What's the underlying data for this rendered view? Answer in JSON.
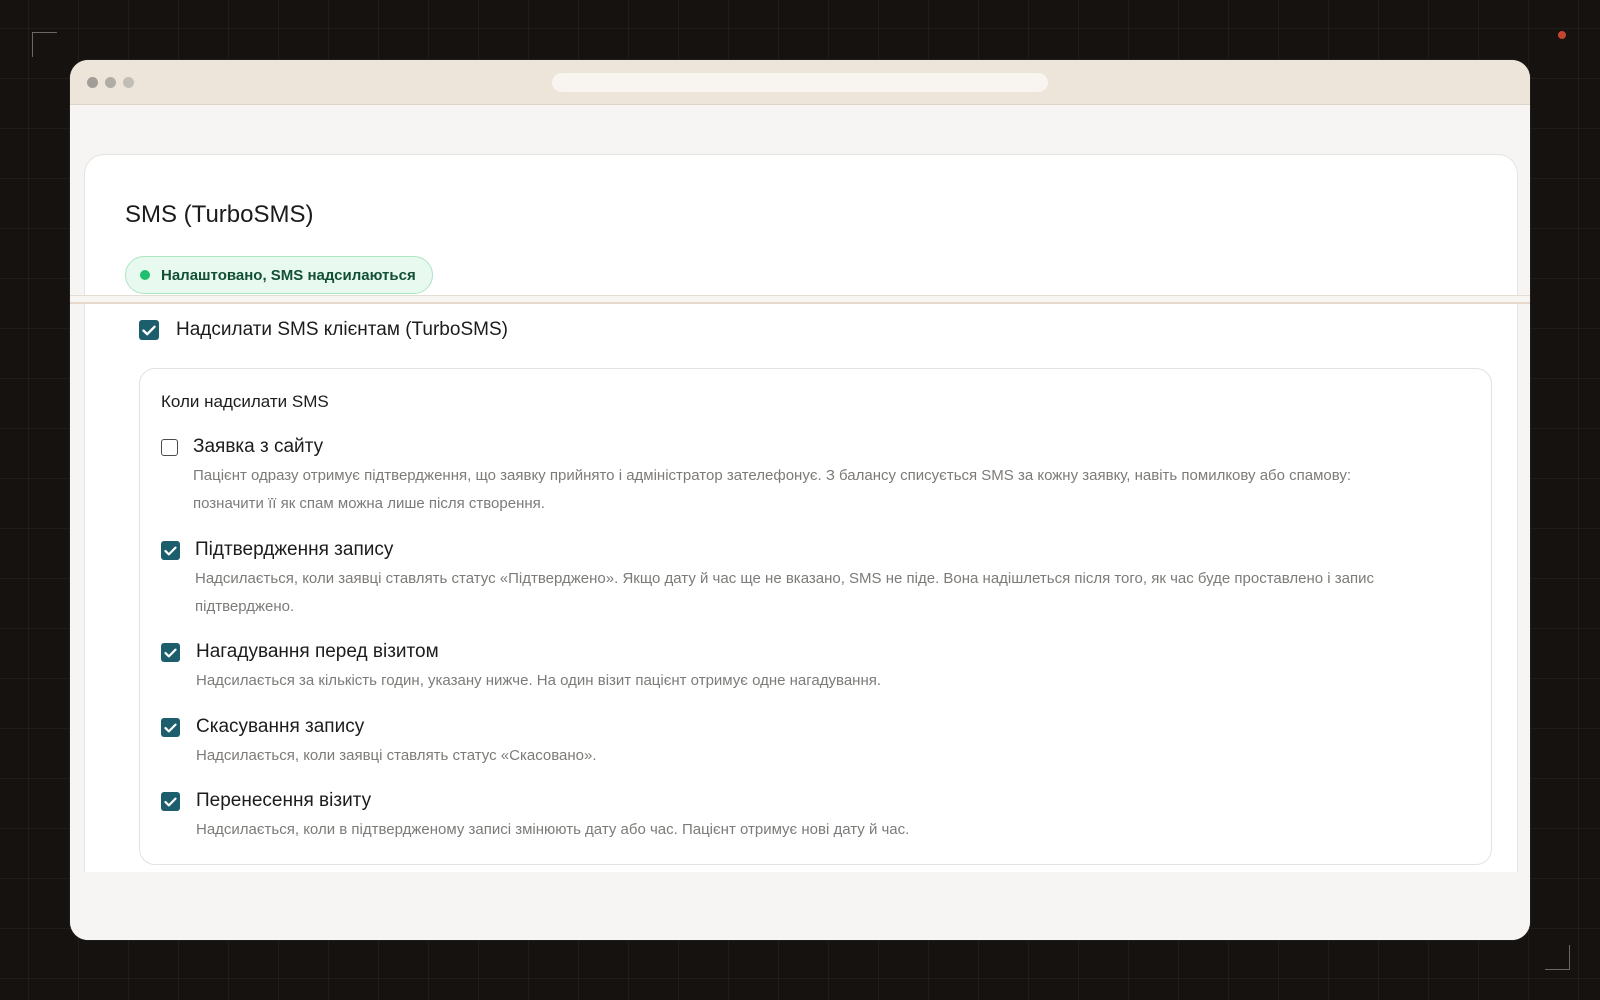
{
  "window": {
    "url": ""
  },
  "card": {
    "title": "SMS (TurboSMS)",
    "status": {
      "text": "Налаштовано, SMS надсилаються",
      "color": "#1fbf6f"
    },
    "enable": {
      "label": "Надсилати SMS клієнтам (TurboSMS)",
      "checked": true
    },
    "when": {
      "title": "Коли надсилати SMS",
      "options": [
        {
          "label": "Заявка з сайту",
          "checked": false,
          "description": "Пацієнт одразу отримує підтвердження, що заявку прийнято і адміністратор зателефонує. З балансу списується SMS за кожну заявку, навіть помилкову або спамову: позначити її як спам можна лише після створення."
        },
        {
          "label": "Підтвердження запису",
          "checked": true,
          "description": "Надсилається, коли заявці ставлять статус «Підтверджено». Якщо дату й час ще не вказано, SMS не піде. Вона надішлеться після того, як час буде проставлено і запис підтверджено."
        },
        {
          "label": "Нагадування перед візитом",
          "checked": true,
          "description": "Надсилається за кількість годин, указану нижче. На один візит пацієнт отримує одне нагадування."
        },
        {
          "label": "Скасування запису",
          "checked": true,
          "description": "Надсилається, коли заявці ставлять статус «Скасовано»."
        },
        {
          "label": "Перенесення візиту",
          "checked": true,
          "description": "Надсилається, коли в підтвердженому записі змінюють дату або час. Пацієнт отримує нові дату й час."
        }
      ]
    }
  },
  "colors": {
    "checkbox_accent": "#1d5e6d",
    "status_green": "#1fbf6f",
    "background": "#151210",
    "titlebar": "#ede4da"
  }
}
